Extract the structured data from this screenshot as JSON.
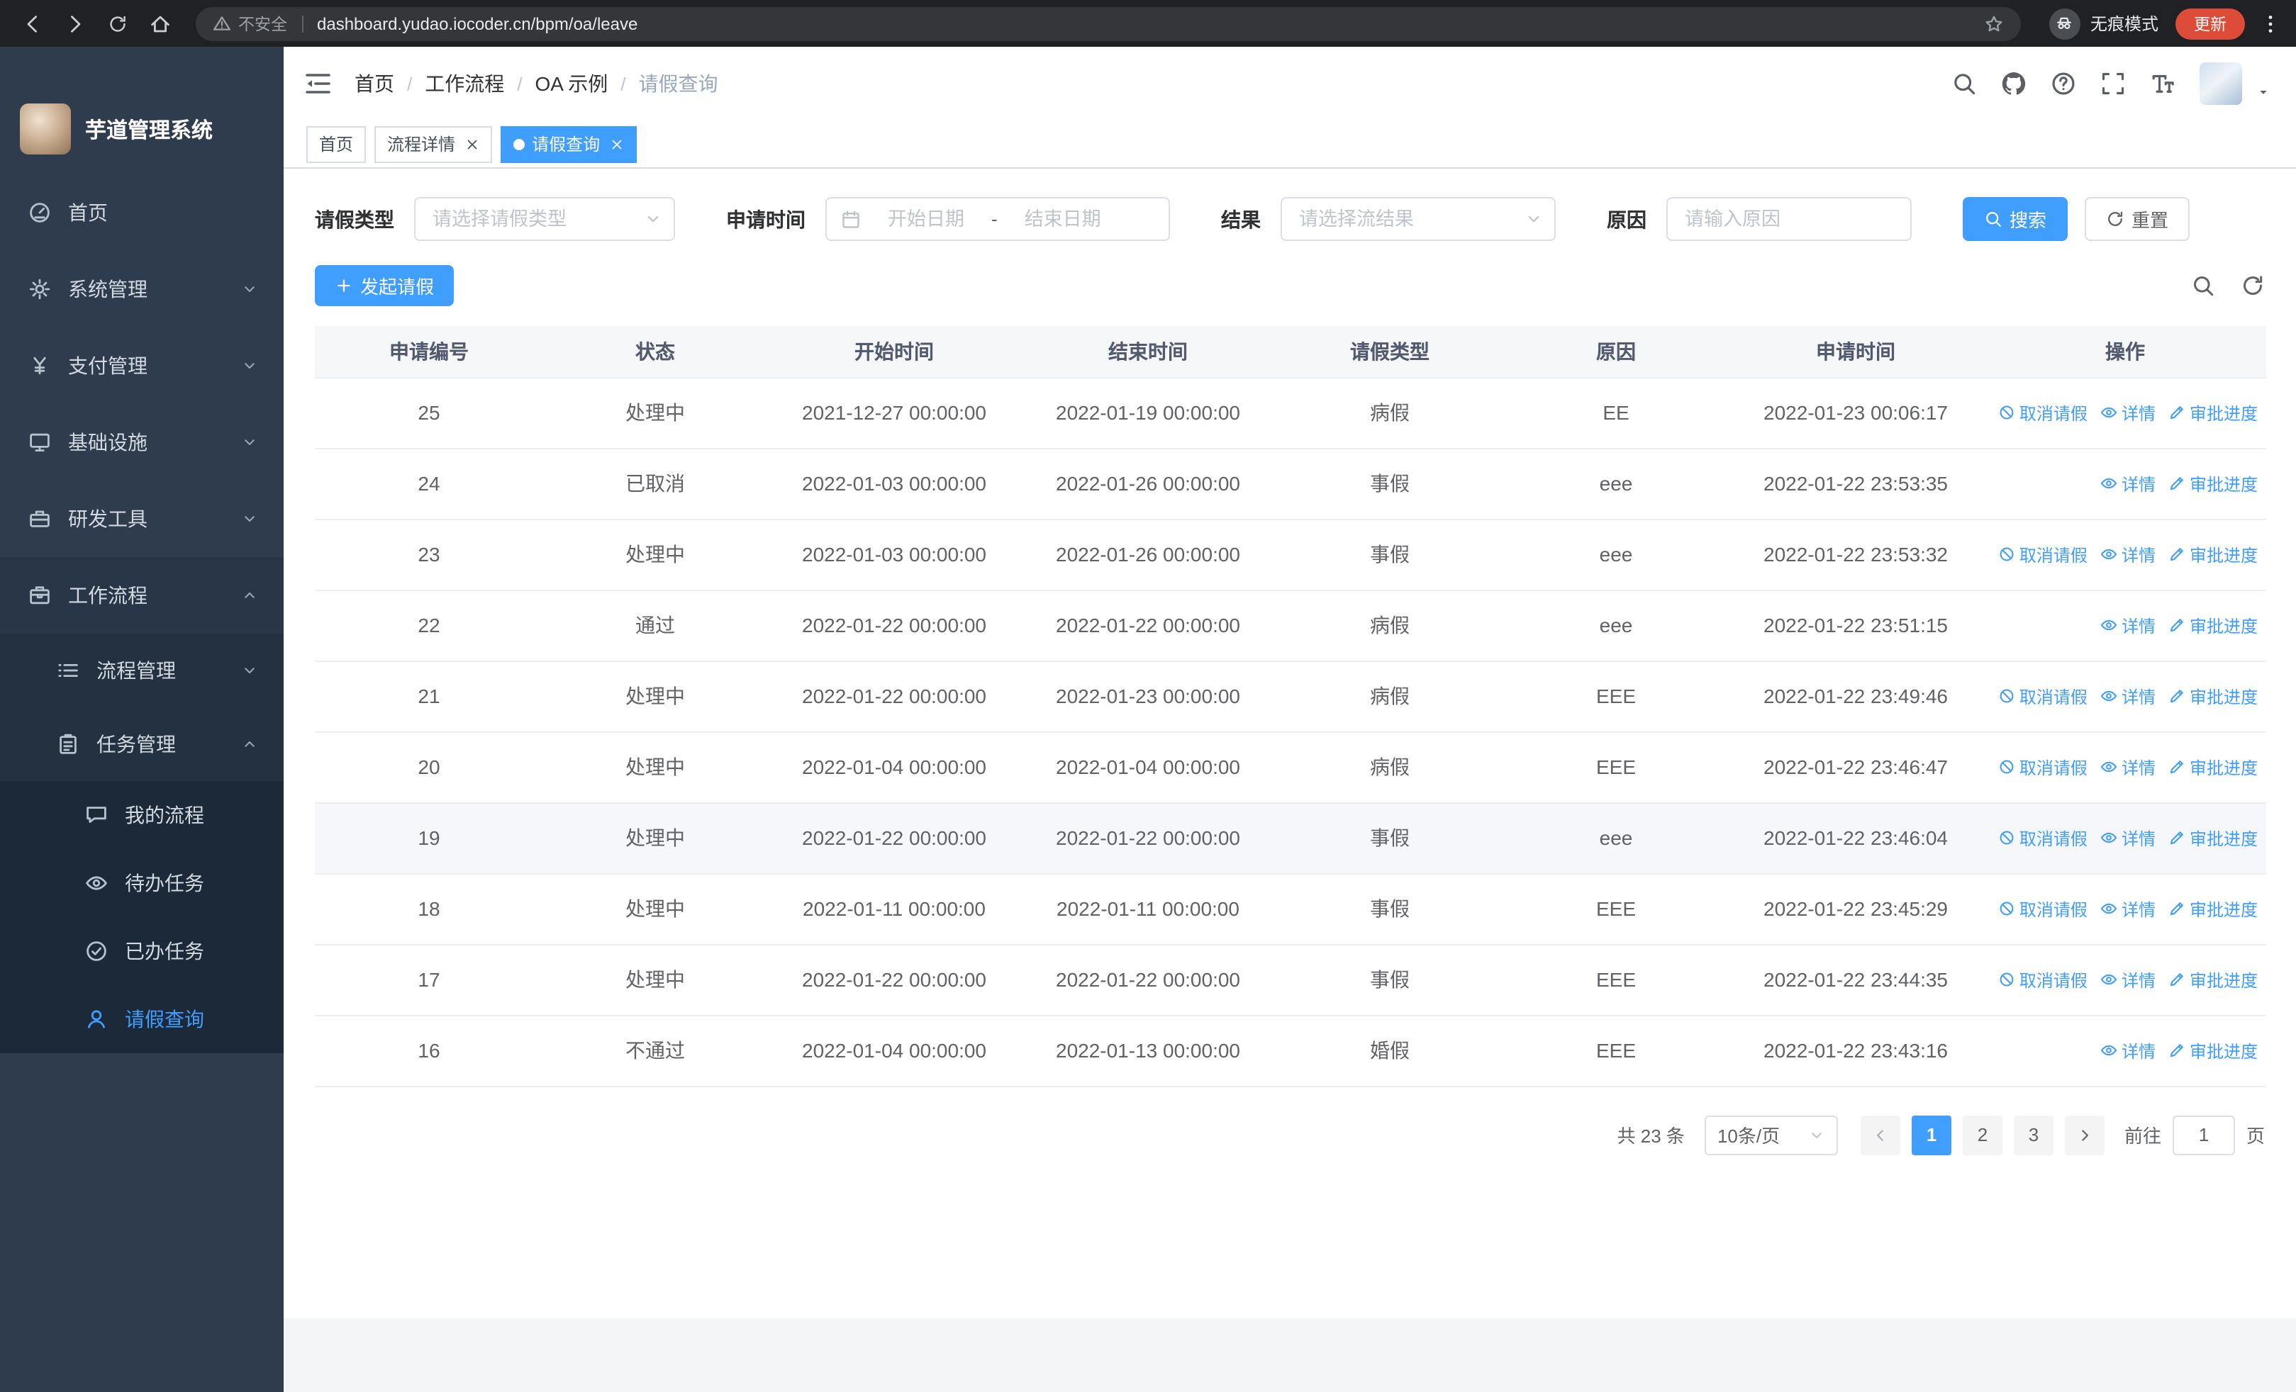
{
  "browser": {
    "security_text": "不安全",
    "url": "dashboard.yudao.iocoder.cn/bpm/oa/leave",
    "incognito_text": "无痕模式",
    "update_text": "更新"
  },
  "sidebar": {
    "logo_title": "芋道管理系统",
    "items": [
      {
        "key": "home",
        "label": "首页",
        "icon": "dashboard",
        "level": 1
      },
      {
        "key": "system",
        "label": "系统管理",
        "icon": "gear",
        "level": 1,
        "expandable": true
      },
      {
        "key": "payment",
        "label": "支付管理",
        "icon": "yen",
        "level": 1,
        "expandable": true
      },
      {
        "key": "infrastructure",
        "label": "基础设施",
        "icon": "infra",
        "level": 1,
        "expandable": true
      },
      {
        "key": "devtools",
        "label": "研发工具",
        "icon": "devtools",
        "level": 1,
        "expandable": true
      },
      {
        "key": "workflow",
        "label": "工作流程",
        "icon": "workflow",
        "level": 1,
        "expandable": true,
        "expanded": true
      },
      {
        "key": "process-mgmt",
        "label": "流程管理",
        "icon": "list",
        "level": 2,
        "expandable": true
      },
      {
        "key": "task-mgmt",
        "label": "任务管理",
        "icon": "tasks",
        "level": 2,
        "expandable": true,
        "expanded": true
      },
      {
        "key": "my-process",
        "label": "我的流程",
        "icon": "chat",
        "level": 3
      },
      {
        "key": "todo-task",
        "label": "待办任务",
        "icon": "eye",
        "level": 3
      },
      {
        "key": "done-task",
        "label": "已办任务",
        "icon": "done",
        "level": 3
      },
      {
        "key": "leave-query",
        "label": "请假查询",
        "icon": "user",
        "level": 3,
        "active": true
      }
    ]
  },
  "header": {
    "breadcrumb": [
      "首页",
      "工作流程",
      "OA 示例",
      "请假查询"
    ],
    "breadcrumb_separator": "/"
  },
  "tabs": [
    {
      "key": "home",
      "label": "首页"
    },
    {
      "key": "process-detail",
      "label": "流程详情",
      "closable": true
    },
    {
      "key": "leave-query",
      "label": "请假查询",
      "closable": true,
      "active": true
    }
  ],
  "filters": {
    "leave_type_label": "请假类型",
    "leave_type_placeholder": "请选择请假类型",
    "apply_time_label": "申请时间",
    "start_date_placeholder": "开始日期",
    "range_separator": "-",
    "end_date_placeholder": "结束日期",
    "result_label": "结果",
    "result_placeholder": "请选择流结果",
    "reason_label": "原因",
    "reason_placeholder": "请输入原因",
    "search_label": "搜索",
    "reset_label": "重置"
  },
  "toolbar": {
    "create_label": "发起请假"
  },
  "table": {
    "columns": [
      "申请编号",
      "状态",
      "开始时间",
      "结束时间",
      "请假类型",
      "原因",
      "申请时间",
      "操作"
    ],
    "column_keys": [
      "id",
      "status",
      "start_time",
      "end_time",
      "leave_type",
      "reason",
      "apply_time"
    ],
    "action_defs": {
      "cancel": {
        "label": "取消请假",
        "icon": "cancel"
      },
      "detail": {
        "label": "详情",
        "icon": "eye"
      },
      "progress": {
        "label": "审批进度",
        "icon": "edit"
      }
    },
    "rows": [
      {
        "id": "25",
        "status": "处理中",
        "start_time": "2021-12-27 00:00:00",
        "end_time": "2022-01-19 00:00:00",
        "leave_type": "病假",
        "reason": "EE",
        "apply_time": "2022-01-23 00:06:17",
        "actions": [
          "cancel",
          "detail",
          "progress"
        ]
      },
      {
        "id": "24",
        "status": "已取消",
        "start_time": "2022-01-03 00:00:00",
        "end_time": "2022-01-26 00:00:00",
        "leave_type": "事假",
        "reason": "eee",
        "apply_time": "2022-01-22 23:53:35",
        "actions": [
          "detail",
          "progress"
        ]
      },
      {
        "id": "23",
        "status": "处理中",
        "start_time": "2022-01-03 00:00:00",
        "end_time": "2022-01-26 00:00:00",
        "leave_type": "事假",
        "reason": "eee",
        "apply_time": "2022-01-22 23:53:32",
        "actions": [
          "cancel",
          "detail",
          "progress"
        ]
      },
      {
        "id": "22",
        "status": "通过",
        "start_time": "2022-01-22 00:00:00",
        "end_time": "2022-01-22 00:00:00",
        "leave_type": "病假",
        "reason": "eee",
        "apply_time": "2022-01-22 23:51:15",
        "actions": [
          "detail",
          "progress"
        ]
      },
      {
        "id": "21",
        "status": "处理中",
        "start_time": "2022-01-22 00:00:00",
        "end_time": "2022-01-23 00:00:00",
        "leave_type": "病假",
        "reason": "EEE",
        "apply_time": "2022-01-22 23:49:46",
        "actions": [
          "cancel",
          "detail",
          "progress"
        ]
      },
      {
        "id": "20",
        "status": "处理中",
        "start_time": "2022-01-04 00:00:00",
        "end_time": "2022-01-04 00:00:00",
        "leave_type": "病假",
        "reason": "EEE",
        "apply_time": "2022-01-22 23:46:47",
        "actions": [
          "cancel",
          "detail",
          "progress"
        ]
      },
      {
        "id": "19",
        "status": "处理中",
        "start_time": "2022-01-22 00:00:00",
        "end_time": "2022-01-22 00:00:00",
        "leave_type": "事假",
        "reason": "eee",
        "apply_time": "2022-01-22 23:46:04",
        "actions": [
          "cancel",
          "detail",
          "progress"
        ],
        "highlighted": true
      },
      {
        "id": "18",
        "status": "处理中",
        "start_time": "2022-01-11 00:00:00",
        "end_time": "2022-01-11 00:00:00",
        "leave_type": "事假",
        "reason": "EEE",
        "apply_time": "2022-01-22 23:45:29",
        "actions": [
          "cancel",
          "detail",
          "progress"
        ]
      },
      {
        "id": "17",
        "status": "处理中",
        "start_time": "2022-01-22 00:00:00",
        "end_time": "2022-01-22 00:00:00",
        "leave_type": "事假",
        "reason": "EEE",
        "apply_time": "2022-01-22 23:44:35",
        "actions": [
          "cancel",
          "detail",
          "progress"
        ]
      },
      {
        "id": "16",
        "status": "不通过",
        "start_time": "2022-01-04 00:00:00",
        "end_time": "2022-01-13 00:00:00",
        "leave_type": "婚假",
        "reason": "EEE",
        "apply_time": "2022-01-22 23:43:16",
        "actions": [
          "detail",
          "progress"
        ]
      }
    ]
  },
  "pagination": {
    "total_text": "共 23 条",
    "page_size_text": "10条/页",
    "pages": [
      "1",
      "2",
      "3"
    ],
    "active_page": "1",
    "goto_label": "前往",
    "goto_value": "1",
    "page_unit_label": "页"
  },
  "colors": {
    "accent": "#409eff",
    "sidebar_bg": "#2f3c4e"
  }
}
